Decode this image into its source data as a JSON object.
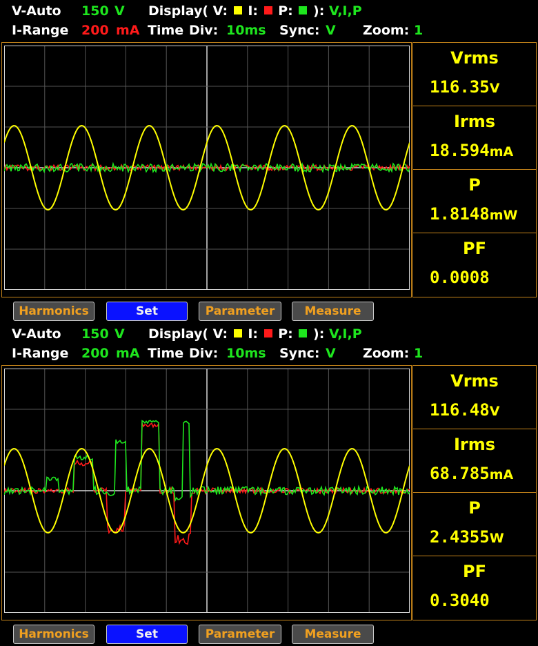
{
  "panels": [
    {
      "header": {
        "v_mode": "V-Auto",
        "v_range": "150",
        "v_unit": "V",
        "display_label": "Display( V:",
        "i_label": "I:",
        "p_label": "P:",
        "display_close": "):",
        "display_value": "V,I,P",
        "i_range_label": "I-Range",
        "i_range": "200",
        "i_unit": "mA",
        "time_label": "Time",
        "div_label": "Div:",
        "div_value": "10ms",
        "sync_label": "Sync:",
        "sync_value": "V",
        "zoom_label": "Zoom:",
        "zoom_value": "1"
      },
      "measurements": [
        {
          "label": "Vrms",
          "value": "116.35",
          "unit": "V"
        },
        {
          "label": "Irms",
          "value": "18.594",
          "unit": "mA"
        },
        {
          "label": "P",
          "value": "1.8148",
          "unit": "mW"
        },
        {
          "label": "PF",
          "value": "0.0008",
          "unit": ""
        }
      ],
      "buttons": [
        {
          "label": "Harmonics",
          "active": false
        },
        {
          "label": "Set",
          "active": true
        },
        {
          "label": "Parameter",
          "active": false
        },
        {
          "label": "Measure",
          "active": false
        }
      ],
      "traces_mode": "idle"
    },
    {
      "header": {
        "v_mode": "V-Auto",
        "v_range": "150",
        "v_unit": "V",
        "display_label": "Display( V:",
        "i_label": "I:",
        "p_label": "P:",
        "display_close": "):",
        "display_value": "V,I,P",
        "i_range_label": "I-Range",
        "i_range": "200",
        "i_unit": "mA",
        "time_label": "Time",
        "div_label": "Div:",
        "div_value": "10ms",
        "sync_label": "Sync:",
        "sync_value": "V",
        "zoom_label": "Zoom:",
        "zoom_value": "1"
      },
      "measurements": [
        {
          "label": "Vrms",
          "value": "116.48",
          "unit": "V"
        },
        {
          "label": "Irms",
          "value": "68.785",
          "unit": "mA"
        },
        {
          "label": "P",
          "value": "2.4355",
          "unit": "W"
        },
        {
          "label": "PF",
          "value": "0.3040",
          "unit": ""
        }
      ],
      "buttons": [
        {
          "label": "Harmonics",
          "active": false
        },
        {
          "label": "Set",
          "active": true
        },
        {
          "label": "Parameter",
          "active": false
        },
        {
          "label": "Measure",
          "active": false
        }
      ],
      "traces_mode": "load"
    }
  ],
  "colors": {
    "voltage": "#ffff00",
    "current": "#ff1a1a",
    "power": "#1ee61e",
    "border": "#c8861a",
    "grid": "#555555",
    "active_button": "#0a12ff"
  }
}
